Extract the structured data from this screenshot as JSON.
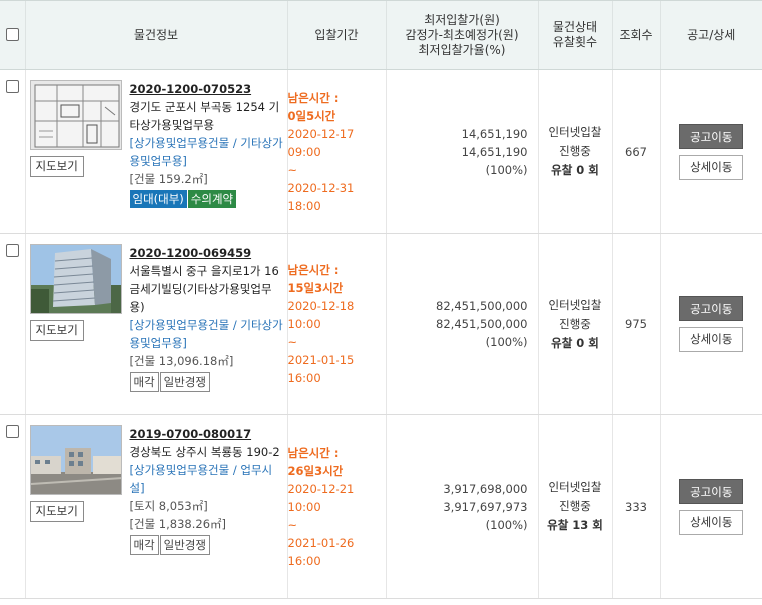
{
  "header": {
    "info": "물건정보",
    "period": "입찰기간",
    "price_line1": "최저입찰가(원)",
    "price_line2": "감정가-최초예정가(원)",
    "price_line3": "최저입찰가율(%)",
    "status_line1": "물건상태",
    "status_line2": "유찰횟수",
    "views": "조회수",
    "actions": "공고/상세"
  },
  "rows": [
    {
      "case_no": "2020-1200-070523",
      "address": "경기도 군포시 부곡동 1254 기타상가용및업무용",
      "category": "[상가용및업무용건물 / 기타상가용및업무용]",
      "area1": "[건물 159.2㎡]",
      "area2": "",
      "tags": [
        "임대(대부)",
        "수의계약"
      ],
      "map_btn": "지도보기",
      "remain_label": "남은시간 :",
      "remain": "0일5시간",
      "start": "2020-12-17 09:00",
      "tilde": "~",
      "end": "2020-12-31 18:00",
      "price_min": "14,651,190",
      "price_appraisal": "14,651,190",
      "rate": "(100%)",
      "status": "인터넷입찰",
      "progress": "진행중",
      "fail": "유찰 0 회",
      "views": "667",
      "notice_btn": "공고이동",
      "detail_btn": "상세이동"
    },
    {
      "case_no": "2020-1200-069459",
      "address": "서울특별시 중구 을지로1가 16 금세기빌딩(기타상가용및업무용)",
      "category": "[상가용및업무용건물 / 기타상가용및업무용]",
      "area1": "[건물 13,096.18㎡]",
      "area2": "",
      "tags": [
        "매각",
        "일반경쟁"
      ],
      "map_btn": "지도보기",
      "remain_label": "남은시간 :",
      "remain": "15일3시간",
      "start": "2020-12-18 10:00",
      "tilde": "~",
      "end": "2021-01-15 16:00",
      "price_min": "82,451,500,000",
      "price_appraisal": "82,451,500,000",
      "rate": "(100%)",
      "status": "인터넷입찰",
      "progress": "진행중",
      "fail": "유찰 0 회",
      "views": "975",
      "notice_btn": "공고이동",
      "detail_btn": "상세이동"
    },
    {
      "case_no": "2019-0700-080017",
      "address": "경상북도 상주시 복룡동 190-2",
      "category": "[상가용및업무용건물 / 업무시설]",
      "area1": "[토지 8,053㎡]",
      "area2": "[건물 1,838.26㎡]",
      "tags": [
        "매각",
        "일반경쟁"
      ],
      "map_btn": "지도보기",
      "remain_label": "남은시간 :",
      "remain": "26일3시간",
      "start": "2020-12-21 10:00",
      "tilde": "~",
      "end": "2021-01-26 16:00",
      "price_min": "3,917,698,000",
      "price_appraisal": "3,917,697,973",
      "rate": "(100%)",
      "status": "인터넷입찰",
      "progress": "진행중",
      "fail": "유찰 13 회",
      "views": "333",
      "notice_btn": "공고이동",
      "detail_btn": "상세이동"
    }
  ],
  "colors": {
    "orange": "#ee6b1f",
    "link_blue": "#2a74b8",
    "header_bg": "#eef4f3",
    "btn_dark": "#6b6b6b"
  }
}
